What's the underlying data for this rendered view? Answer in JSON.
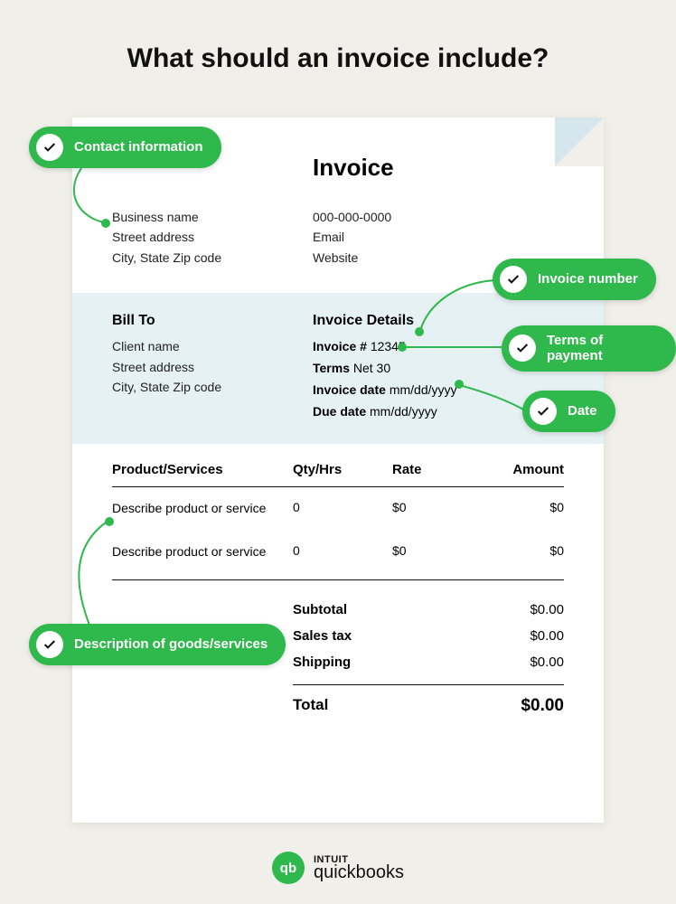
{
  "title": "What should an invoice include?",
  "doc_title": "Invoice",
  "from": {
    "business": "Business name",
    "street": "Street address",
    "city": "City, State Zip code",
    "phone": "000-000-0000",
    "email": "Email",
    "website": "Website"
  },
  "bill_to": {
    "heading": "Bill To",
    "client": "Client name",
    "street": "Street address",
    "city": "City, State Zip code"
  },
  "details": {
    "heading": "Invoice Details",
    "invoice_num_label": "Invoice #",
    "invoice_num": "12345",
    "terms_label": "Terms",
    "terms": "Net 30",
    "inv_date_label": "Invoice date",
    "inv_date": "mm/dd/yyyy",
    "due_date_label": "Due date",
    "due_date": "mm/dd/yyyy"
  },
  "table": {
    "h_desc": "Product/Services",
    "h_qty": "Qty/Hrs",
    "h_rate": "Rate",
    "h_amt": "Amount",
    "rows": [
      {
        "desc": "Describe product or service",
        "qty": "0",
        "rate": "$0",
        "amt": "$0"
      },
      {
        "desc": "Describe product or service",
        "qty": "0",
        "rate": "$0",
        "amt": "$0"
      }
    ]
  },
  "totals": {
    "subtotal_label": "Subtotal",
    "subtotal": "$0.00",
    "tax_label": "Sales tax",
    "tax": "$0.00",
    "ship_label": "Shipping",
    "ship": "$0.00",
    "total_label": "Total",
    "total": "$0.00"
  },
  "callouts": {
    "contact": "Contact information",
    "invoice_number": "Invoice number",
    "terms": "Terms of payment",
    "date": "Date",
    "description": "Description of goods/services"
  },
  "brand": {
    "intuit": "INTUIT",
    "qb": "quickbooks",
    "mark": "qb"
  }
}
